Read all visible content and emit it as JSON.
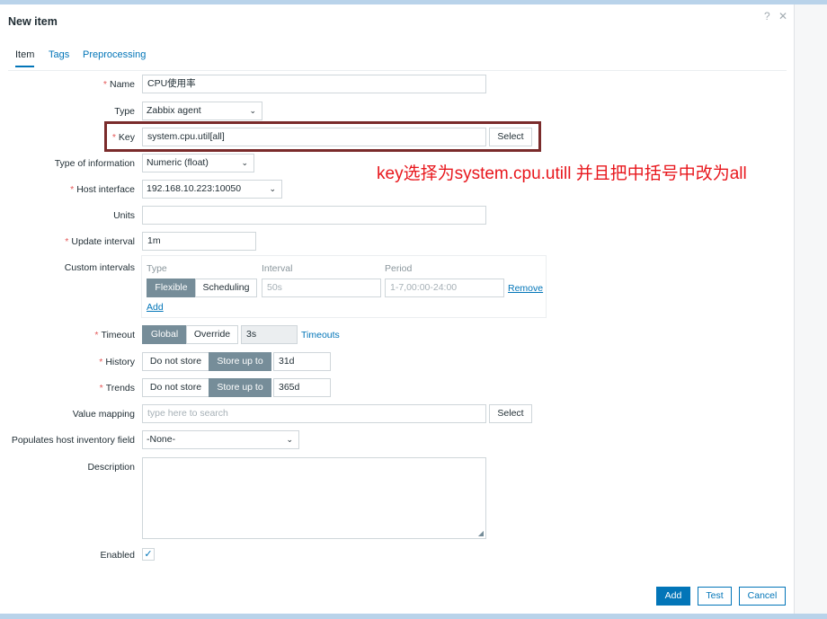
{
  "dialog": {
    "title": "New item",
    "help_glyph": "?",
    "close_glyph": "✕"
  },
  "tabs": [
    {
      "label": "Item",
      "active": true
    },
    {
      "label": "Tags",
      "active": false
    },
    {
      "label": "Preprocessing",
      "active": false
    }
  ],
  "required_mark": "*",
  "form": {
    "name": {
      "label": "Name",
      "value": "CPU使用率",
      "required": true
    },
    "type": {
      "label": "Type",
      "value": "Zabbix agent"
    },
    "key": {
      "label": "Key",
      "value": "system.cpu.util[all]",
      "required": true,
      "button": "Select"
    },
    "type_of_information": {
      "label": "Type of information",
      "value": "Numeric (float)"
    },
    "host_interface": {
      "label": "Host interface",
      "value": "192.168.10.223:10050",
      "required": true
    },
    "units": {
      "label": "Units",
      "value": ""
    },
    "update_interval": {
      "label": "Update interval",
      "value": "1m",
      "required": true
    },
    "custom_intervals": {
      "label": "Custom intervals",
      "columns": [
        "Type",
        "Interval",
        "Period"
      ],
      "row": {
        "type_options": [
          "Flexible",
          "Scheduling"
        ],
        "selected": "Flexible",
        "interval_placeholder": "50s",
        "period_placeholder": "1-7,00:00-24:00",
        "remove_label": "Remove"
      },
      "add_label": "Add"
    },
    "timeout": {
      "label": "Timeout",
      "required": true,
      "options": [
        "Global",
        "Override"
      ],
      "selected": "Global",
      "value": "3s",
      "link": "Timeouts"
    },
    "history": {
      "label": "History",
      "required": true,
      "options": [
        "Do not store",
        "Store up to"
      ],
      "selected": "Store up to",
      "value": "31d"
    },
    "trends": {
      "label": "Trends",
      "required": true,
      "options": [
        "Do not store",
        "Store up to"
      ],
      "selected": "Store up to",
      "value": "365d"
    },
    "value_mapping": {
      "label": "Value mapping",
      "placeholder": "type here to search",
      "button": "Select"
    },
    "inventory_field": {
      "label": "Populates host inventory field",
      "value": "-None-"
    },
    "description": {
      "label": "Description",
      "value": ""
    },
    "enabled": {
      "label": "Enabled",
      "checked": true,
      "glyph": "✓"
    }
  },
  "footer": {
    "add": "Add",
    "test": "Test",
    "cancel": "Cancel"
  },
  "annotation": {
    "text": "key选择为system.cpu.utill 并且把中括号中改为all",
    "color": "#e8171d",
    "highlight_color": "#7a2b2b"
  },
  "colors": {
    "accent": "#0275b8",
    "segment_selected": "#768d99",
    "required": "#e45959"
  }
}
